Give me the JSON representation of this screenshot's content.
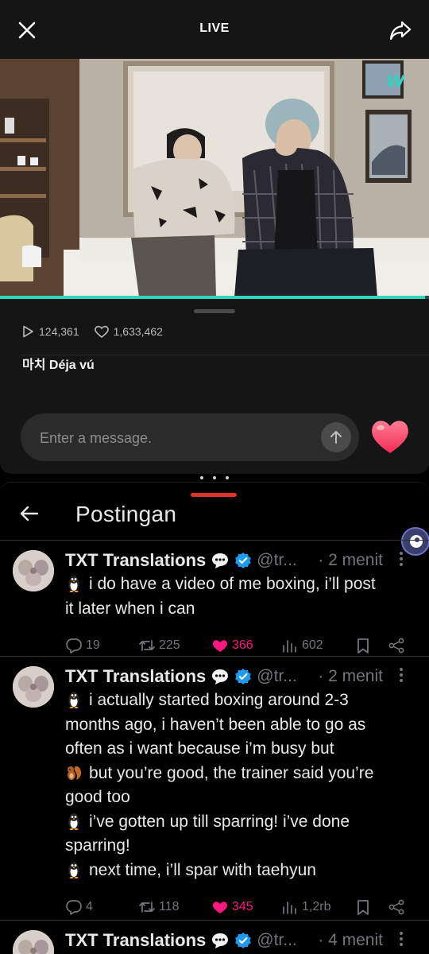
{
  "live": {
    "title": "LIVE",
    "progress_fraction": 0.99,
    "views": "124,361",
    "likes": "1,633,462",
    "caption": "마치 Déja vú",
    "input_placeholder": "Enter a message.",
    "brand_color": "#2fd6c0"
  },
  "x": {
    "header_title": "Postingan",
    "tweets": [
      {
        "name": "TXT Translations",
        "handle": "@tr...",
        "time": "· 2 menit",
        "lines": [
          {
            "emoji": "penguin",
            "text": "i do have a video of me boxing, i’ll post"
          },
          {
            "emoji": "",
            "text": "it later when i can"
          }
        ],
        "replies": "19",
        "retweets": "225",
        "likes": "366",
        "views": "602"
      },
      {
        "name": "TXT Translations",
        "handle": "@tr...",
        "time": "· 2 menit",
        "lines": [
          {
            "emoji": "penguin",
            "text": "i actually started boxing around 2-3"
          },
          {
            "emoji": "",
            "text": "months ago, i haven’t been able to go as"
          },
          {
            "emoji": "",
            "text": "often as i want because i’m busy but"
          },
          {
            "emoji": "squirrel",
            "text": "but you’re good, the trainer said you’re"
          },
          {
            "emoji": "",
            "text": "good too"
          },
          {
            "emoji": "penguin",
            "text": "i’ve gotten up till sparring! i’ve done"
          },
          {
            "emoji": "",
            "text": "sparring!"
          },
          {
            "emoji": "penguin",
            "text": "next time, i’ll spar with taehyun"
          }
        ],
        "replies": "4",
        "retweets": "118",
        "likes": "345",
        "views": "1,2rb"
      },
      {
        "name": "TXT Translations",
        "handle": "@tr...",
        "time": "· 4 menit",
        "lines": [],
        "replies": "",
        "retweets": "",
        "likes": "",
        "views": ""
      }
    ],
    "like_color": "#f91880",
    "verified_color": "#1d9bf0"
  }
}
